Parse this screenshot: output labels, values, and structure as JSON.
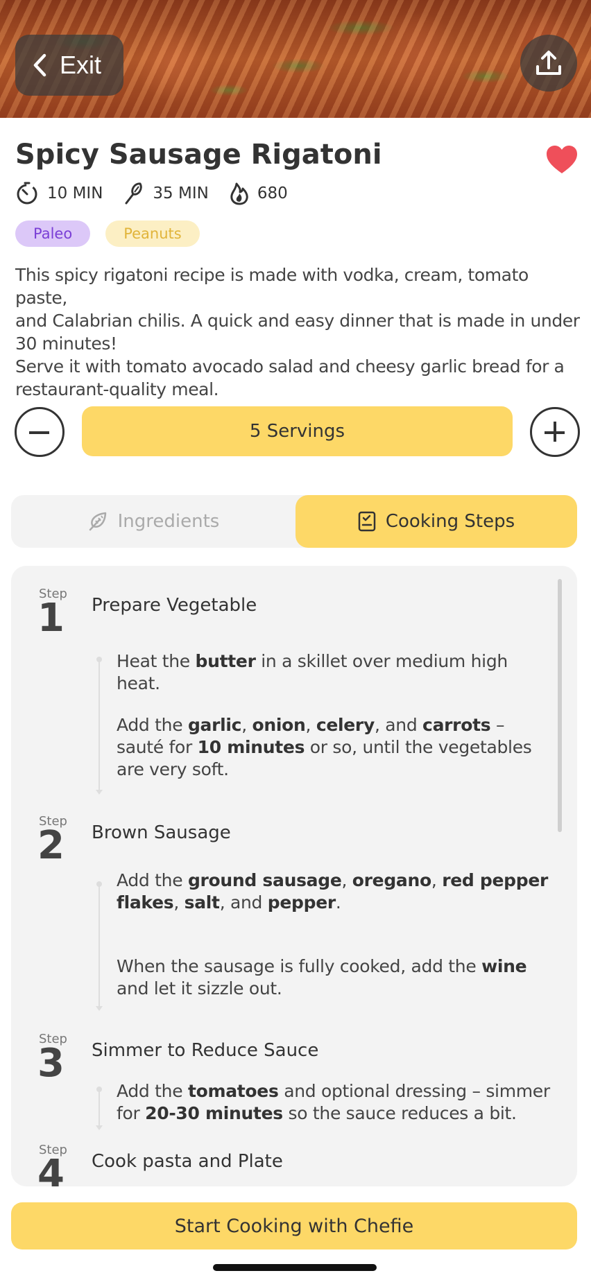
{
  "header": {
    "exit_label": "Exit"
  },
  "recipe": {
    "title": "Spicy Sausage Rigatoni",
    "favorite_color": "#ef4f5a",
    "meta": {
      "prep_time": "10 MIN",
      "cook_time": "35 MIN",
      "calories": "680"
    },
    "tags": [
      "Paleo",
      "Peanuts"
    ],
    "description": "This spicy rigatoni recipe is made with vodka, cream, tomato paste, and Calabrian chilis. A quick and easy dinner that is made in under 30 minutes!\nServe it with tomato avocado salad and cheesy garlic bread for a restaurant-quality meal.",
    "description_lines": [
      "This spicy rigatoni recipe is made with vodka, cream, tomato paste,",
      "and Calabrian chilis. A quick and easy dinner that is made in under",
      "30 minutes!",
      "Serve it with tomato avocado salad and cheesy garlic bread for a",
      "restaurant-quality meal."
    ]
  },
  "servings": {
    "label": "5 Servings"
  },
  "tabs": {
    "ingredients": "Ingredients",
    "cooking_steps": "Cooking Steps",
    "active": "cooking_steps"
  },
  "steps": {
    "step_word": "Step",
    "items": [
      {
        "number": "1",
        "title": "Prepare Vegetable"
      },
      {
        "number": "2",
        "title": "Brown Sausage"
      },
      {
        "number": "3",
        "title": "Simmer to Reduce Sauce"
      },
      {
        "number": "4",
        "title": "Cook pasta and Plate"
      }
    ],
    "instructions": {
      "s1a": [
        "Heat the ",
        "butter",
        " in a skillet over medium high heat."
      ],
      "s1b": [
        "Add the ",
        "garlic",
        ", ",
        "onion",
        ", ",
        "celery",
        ", and ",
        "carrots",
        " – sauté for ",
        "10 minutes",
        " or so, until the vegetables are very soft."
      ],
      "s2a": [
        "Add the ",
        "ground sausage",
        ", ",
        "oregano",
        ", ",
        "red pepper flakes",
        ", ",
        "salt",
        ", and ",
        "pepper",
        "."
      ],
      "s2b": [
        "When the sausage is fully cooked, add the ",
        "wine",
        " and let it sizzle out."
      ],
      "s3a": [
        "Add the ",
        "tomatoes",
        " and optional dressing – simmer for ",
        "20-30 minutes",
        " so the sauce reduces a bit."
      ]
    }
  },
  "footer": {
    "start_label": "Start Cooking with Chefie"
  },
  "colors": {
    "accent_yellow": "#fdd867",
    "paleo_bg": "#dcc8f8",
    "paleo_text": "#7a3fd6",
    "peanuts_bg": "#fcefc4",
    "peanuts_text": "#e1b43a"
  },
  "icons": [
    "chevron-left-icon",
    "share-icon",
    "heart-icon",
    "timer-icon",
    "whisk-icon",
    "flame-icon",
    "minus-icon",
    "plus-icon",
    "leaf-icon",
    "recipe-book-icon"
  ]
}
